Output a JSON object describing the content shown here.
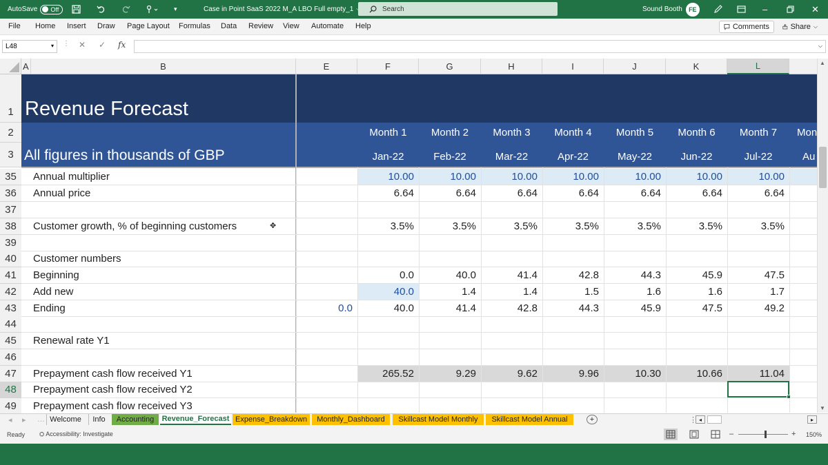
{
  "titlebar": {
    "autosave_label": "AutoSave",
    "autosave_state": "Off",
    "doc_title": "Case in Point SaaS 2022 M_A LBO Full empty_1",
    "search_placeholder": "Search",
    "user_name": "Sound Booth",
    "user_initials": "FE"
  },
  "menu": {
    "items": [
      "File",
      "Home",
      "Insert",
      "Draw",
      "Page Layout",
      "Formulas",
      "Data",
      "Review",
      "View",
      "Automate",
      "Help"
    ],
    "comments_label": "Comments",
    "share_label": "Share"
  },
  "formula_bar": {
    "name_box": "L48",
    "fx_label": "fx",
    "formula": ""
  },
  "columns": [
    "A",
    "B",
    "E",
    "F",
    "G",
    "H",
    "I",
    "J",
    "K",
    "L"
  ],
  "header": {
    "title": "Revenue Forecast",
    "subtitle": "All figures in thousands of GBP",
    "months": [
      "Month 1",
      "Month 2",
      "Month 3",
      "Month 4",
      "Month 5",
      "Month 6",
      "Month 7",
      "Mon"
    ],
    "dates": [
      "Jan-22",
      "Feb-22",
      "Mar-22",
      "Apr-22",
      "May-22",
      "Jun-22",
      "Jul-22",
      "Au"
    ],
    "row_numbers": [
      "1",
      "2",
      "3"
    ]
  },
  "rows": [
    {
      "num": "35",
      "label": "Annual multiplier",
      "e": "",
      "values": [
        "10.00",
        "10.00",
        "10.00",
        "10.00",
        "10.00",
        "10.00",
        "10.00"
      ]
    },
    {
      "num": "36",
      "label": "Annual price",
      "e": "",
      "values": [
        "6.64",
        "6.64",
        "6.64",
        "6.64",
        "6.64",
        "6.64",
        "6.64"
      ]
    },
    {
      "num": "37",
      "label": "",
      "e": "",
      "values": [
        "",
        "",
        "",
        "",
        "",
        "",
        ""
      ]
    },
    {
      "num": "38",
      "label": "Customer growth, % of beginning customers",
      "e": "",
      "values": [
        "3.5%",
        "3.5%",
        "3.5%",
        "3.5%",
        "3.5%",
        "3.5%",
        "3.5%"
      ]
    },
    {
      "num": "39",
      "label": "",
      "e": "",
      "values": [
        "",
        "",
        "",
        "",
        "",
        "",
        ""
      ]
    },
    {
      "num": "40",
      "label": "Customer numbers",
      "e": "",
      "values": [
        "",
        "",
        "",
        "",
        "",
        "",
        ""
      ]
    },
    {
      "num": "41",
      "label": "Beginning",
      "e": "",
      "values": [
        "0.0",
        "40.0",
        "41.4",
        "42.8",
        "44.3",
        "45.9",
        "47.5"
      ]
    },
    {
      "num": "42",
      "label": "Add new",
      "e": "",
      "values": [
        "40.0",
        "1.4",
        "1.4",
        "1.5",
        "1.6",
        "1.6",
        "1.7"
      ]
    },
    {
      "num": "43",
      "label": "Ending",
      "e": "0.0",
      "values": [
        "40.0",
        "41.4",
        "42.8",
        "44.3",
        "45.9",
        "47.5",
        "49.2"
      ]
    },
    {
      "num": "44",
      "label": "",
      "e": "",
      "values": [
        "",
        "",
        "",
        "",
        "",
        "",
        ""
      ]
    },
    {
      "num": "45",
      "label": "Renewal rate Y1",
      "e": "",
      "values": [
        "",
        "",
        "",
        "",
        "",
        "",
        ""
      ]
    },
    {
      "num": "46",
      "label": "",
      "e": "",
      "values": [
        "",
        "",
        "",
        "",
        "",
        "",
        ""
      ]
    },
    {
      "num": "47",
      "label": "Prepayment cash flow received Y1",
      "e": "",
      "values": [
        "265.52",
        "9.29",
        "9.62",
        "9.96",
        "10.30",
        "10.66",
        "11.04"
      ]
    },
    {
      "num": "48",
      "label": "Prepayment cash flow received Y2",
      "e": "",
      "values": [
        "",
        "",
        "",
        "",
        "",
        "",
        ""
      ]
    },
    {
      "num": "49",
      "label": "Prepayment cash flow received Y3",
      "e": "",
      "values": [
        "",
        "",
        "",
        "",
        "",
        "",
        ""
      ]
    }
  ],
  "sheet_tabs": [
    "Welcome",
    "Info",
    "Accounting",
    "Revenue_Forecast",
    "Expense_Breakdown",
    "Monthly_Dashboard",
    "Skillcast Model Monthly",
    "Skillcast Model Annual"
  ],
  "status": {
    "ready": "Ready",
    "accessibility": "Accessibility: Investigate",
    "zoom": "150%"
  },
  "colors": {
    "excel_green": "#217346",
    "header_navy": "#1f3864",
    "header_blue": "#2f5597",
    "input_blue": "#ddebf7",
    "gray_band": "#d9d9d9",
    "tab_green": "#70ad47",
    "tab_orange": "#ffc000"
  }
}
